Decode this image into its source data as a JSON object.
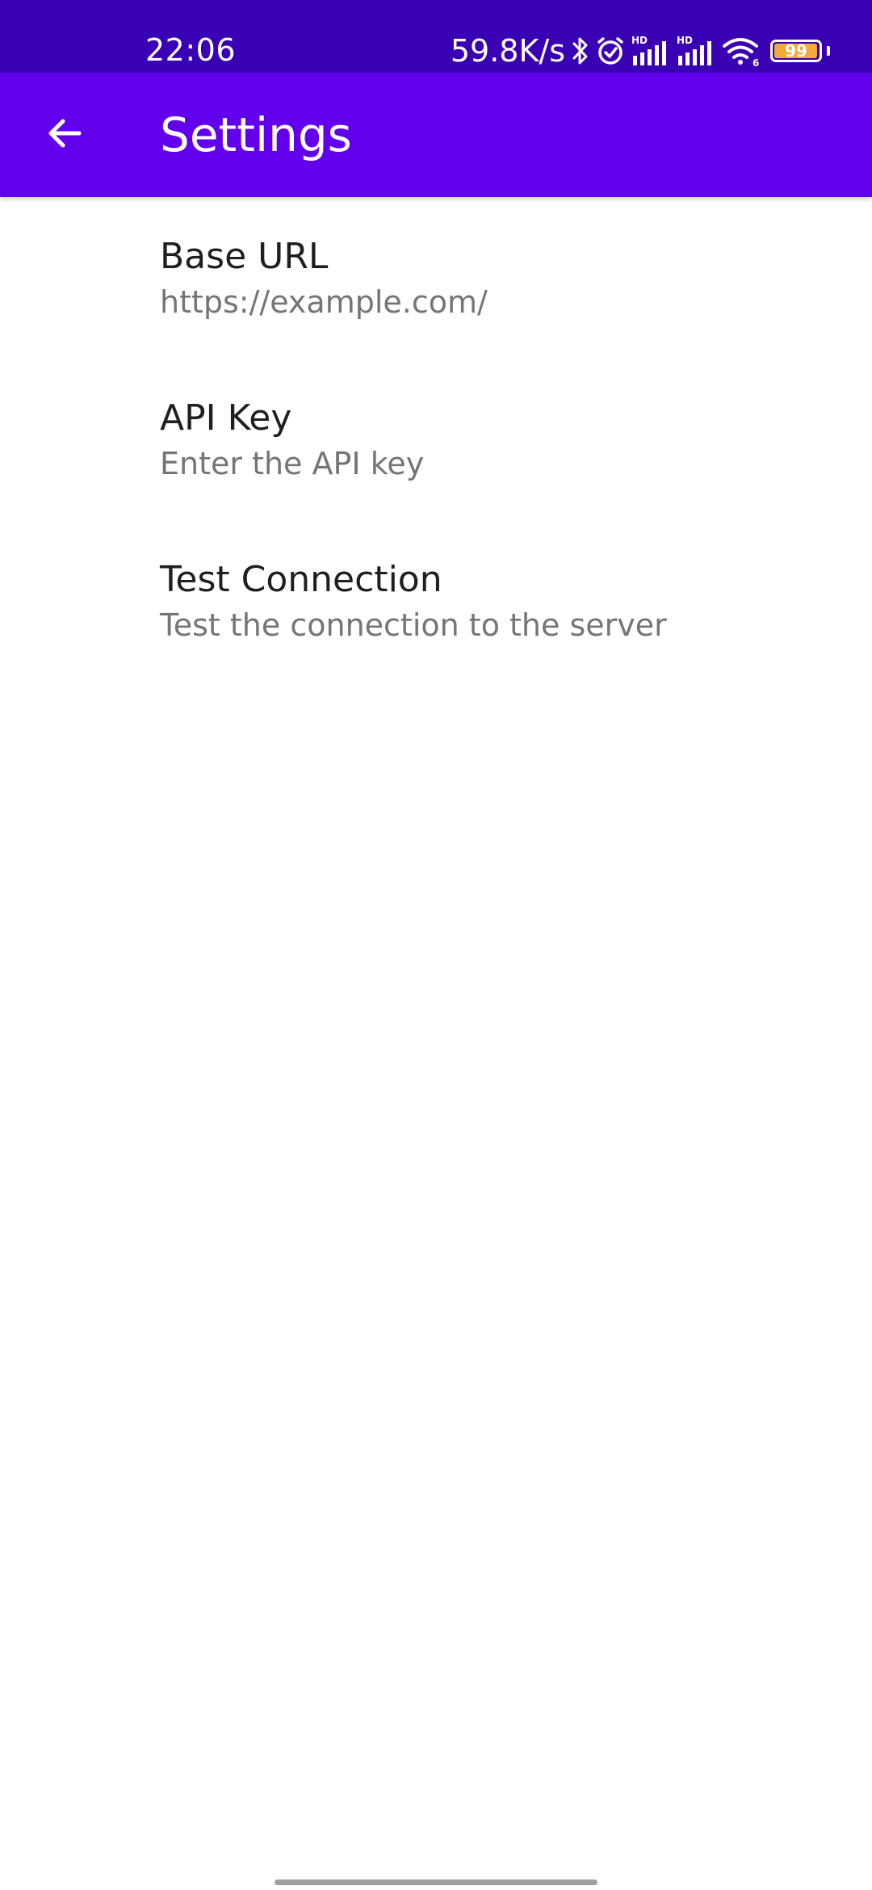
{
  "status_bar": {
    "time": "22:06",
    "network_speed": "59.8K/s",
    "battery_level": "99",
    "battery_fraction": 0.99,
    "icons": [
      "bluetooth-icon",
      "alarm-icon",
      "hd-signal-icon",
      "hd-signal-icon",
      "wifi-icon",
      "battery-icon"
    ]
  },
  "app_bar": {
    "title": "Settings",
    "back_icon": "arrow-back-icon"
  },
  "preferences": [
    {
      "title": "Base URL",
      "summary": "https://example.com/"
    },
    {
      "title": "API Key",
      "summary": "Enter the API key"
    },
    {
      "title": "Test Connection",
      "summary": "Test the connection to the server"
    }
  ],
  "colors": {
    "status_bar": "#3a00b4",
    "app_bar": "#6200ee",
    "title_text": "#1f1f1f",
    "summary_text": "#757575",
    "battery_fill": "#f2a93b"
  }
}
